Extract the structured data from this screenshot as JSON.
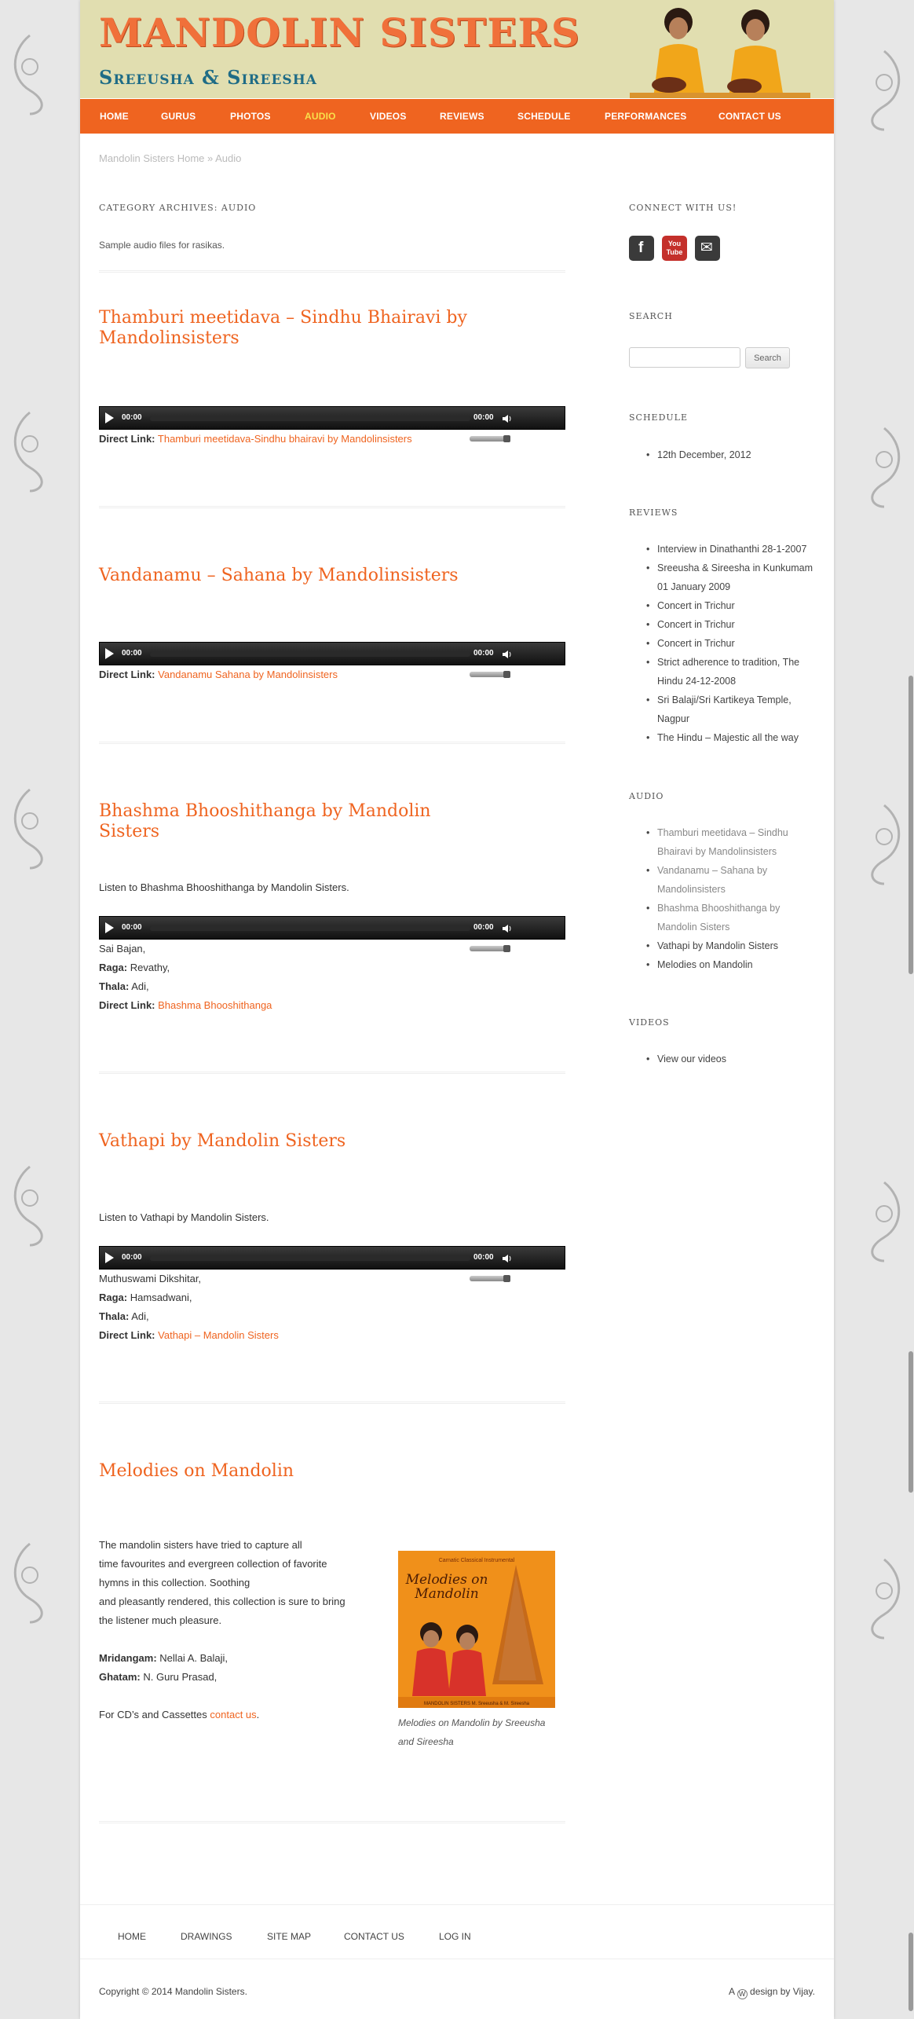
{
  "header": {
    "title": "MANDOLIN SISTERS",
    "subtitle": "Sreeusha & Sireesha"
  },
  "nav": {
    "items": [
      "HOME",
      "GURUS",
      "PHOTOS",
      "AUDIO",
      "VIDEOS",
      "REVIEWS",
      "SCHEDULE",
      "PERFORMANCES",
      "CONTACT US"
    ],
    "current": "AUDIO"
  },
  "breadcrumb": "Mandolin Sisters Home » Audio",
  "archive": {
    "title": "CATEGORY ARCHIVES: AUDIO",
    "description": "Sample audio files for rasikas."
  },
  "player": {
    "time_start": "00:00",
    "time_end": "00:00"
  },
  "posts": [
    {
      "title": "Thamburi meetidava – Sindhu Bhairavi by Mandolinsisters",
      "direct_label": "Direct Link:",
      "direct_link": "Thamburi meetidava-Sindhu bhairavi by Mandolinsisters"
    },
    {
      "title": "Vandanamu – Sahana by Mandolinsisters",
      "direct_label": "Direct Link:",
      "direct_link": "Vandanamu Sahana by Mandolinsisters"
    },
    {
      "title": "Bhashma Bhooshithanga by Mandolin Sisters",
      "intro": "Listen to Bhashma Bhooshithanga by Mandolin Sisters.",
      "composer": "Sai Bajan,",
      "raga_label": "Raga:",
      "raga": "Revathy,",
      "thala_label": "Thala:",
      "thala": "Adi,",
      "direct_label": "Direct Link:",
      "direct_link": "Bhashma Bhooshithanga"
    },
    {
      "title": "Vathapi by Mandolin Sisters",
      "intro": "Listen to Vathapi by Mandolin Sisters.",
      "composer": "Muthuswami Dikshitar,",
      "raga_label": "Raga:",
      "raga": "Hamsadwani,",
      "thala_label": "Thala:",
      "thala": "Adi,",
      "direct_label": "Direct Link:",
      "direct_link": "Vathapi – Mandolin Sisters"
    },
    {
      "title": "Melodies on Mandolin",
      "body_lines": [
        "The mandolin sisters have tried to capture all",
        "time favourites and evergreen collection of favorite",
        "hymns in this collection. Soothing",
        "and pleasantly rendered, this collection is sure to bring",
        "the listener much pleasure."
      ],
      "mridangam_label": "Mridangam:",
      "mridangam": "Nellai A. Balaji,",
      "ghatam_label": "Ghatam:",
      "ghatam": "N. Guru Prasad,",
      "cd_prefix": "For CD’s and Cassettes",
      "cd_link": "contact us",
      "cd_suffix": ".",
      "cover_top_text": "Carnatic Classical Instrumental",
      "cover_title_1": "Melodies on",
      "cover_title_2": "Mandolin",
      "cover_footer": "MANDOLIN SISTERS   M. Sreeusha & M. Sireesha",
      "caption": "Melodies on Mandolin by Sreeusha and Sireesha"
    }
  ],
  "sidebar": {
    "connect_title": "CONNECT WITH US!",
    "social": [
      {
        "name": "facebook",
        "glyph": "f",
        "color": "#3a3a3a"
      },
      {
        "name": "youtube",
        "glyph": "You Tube",
        "color": "#c4302b"
      },
      {
        "name": "email",
        "glyph": "✉",
        "color": "#3a3a3a"
      }
    ],
    "search_title": "SEARCH",
    "search_button": "Search",
    "schedule_title": "SCHEDULE",
    "schedule_items": [
      "12th December, 2012"
    ],
    "reviews_title": "REVIEWS",
    "reviews_items": [
      "Interview in Dinathanthi 28-1-2007",
      "Sreeusha & Sireesha in Kunkumam 01 January 2009",
      "Concert in Trichur",
      "Concert in Trichur",
      "Concert in Trichur",
      "Strict adherence to tradition, The Hindu 24-12-2008",
      "Sri Balaji/Sri Kartikeya Temple, Nagpur",
      "The Hindu – Majestic all the way"
    ],
    "audio_title": "AUDIO",
    "audio_items": [
      "Thamburi meetidava – Sindhu Bhairavi by Mandolinsisters",
      "Vandanamu – Sahana by Mandolinsisters",
      "Bhashma Bhooshithanga by Mandolin Sisters",
      "Vathapi by Mandolin Sisters",
      "Melodies on Mandolin"
    ],
    "videos_title": "VIDEOS",
    "videos_items": [
      "View our videos"
    ]
  },
  "footer": {
    "nav": [
      "HOME",
      "DRAWINGS",
      "SITE MAP",
      "CONTACT US",
      "LOG IN"
    ],
    "copyright": "Copyright © 2014 Mandolin Sisters.",
    "credit_prefix": "A",
    "credit_mid": "design by",
    "credit_name": "Vijay."
  },
  "colors": {
    "accent": "#ef6420",
    "nav_bg": "#ef6420",
    "nav_current": "#f9e04b",
    "header_bg": "#e1deb0",
    "subtitle": "#1f6c86"
  }
}
